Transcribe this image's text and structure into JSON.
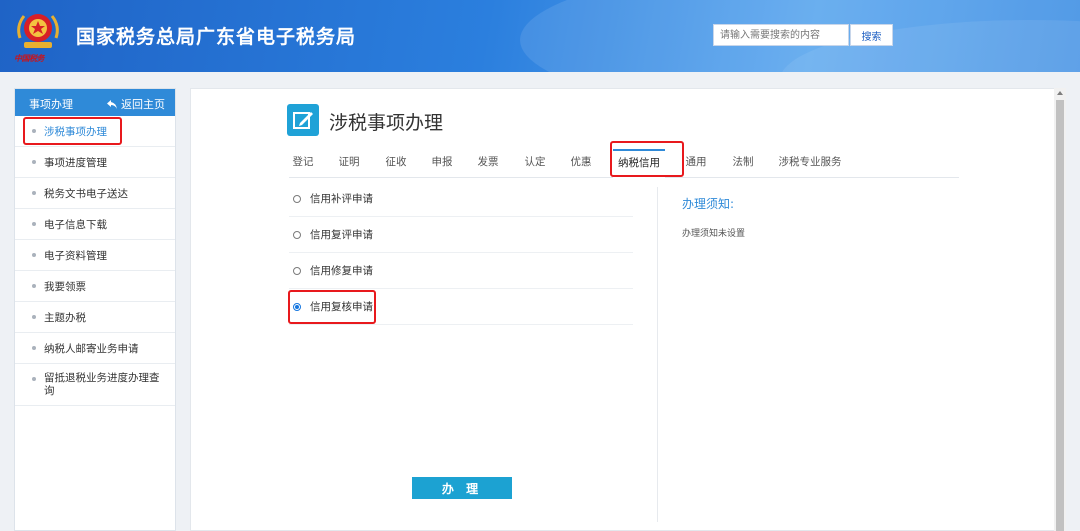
{
  "header": {
    "site_title": "国家税务总局广东省电子税务局",
    "slogan": "中国税务",
    "search_placeholder": "请输入需要搜索的内容",
    "search_button": "搜索"
  },
  "sidebar": {
    "title": "事项办理",
    "back_label": "返回主页",
    "items": [
      {
        "label": "涉税事项办理",
        "active": true
      },
      {
        "label": "事项进度管理"
      },
      {
        "label": "税务文书电子送达"
      },
      {
        "label": "电子信息下载"
      },
      {
        "label": "电子资料管理"
      },
      {
        "label": "我要领票"
      },
      {
        "label": "主题办税"
      },
      {
        "label": "纳税人邮寄业务申请"
      },
      {
        "label": "留抵退税业务进度办理查询"
      }
    ]
  },
  "main": {
    "page_title": "涉税事项办理",
    "tabs": [
      "登记",
      "证明",
      "征收",
      "申报",
      "发票",
      "认定",
      "优惠",
      "纳税信用",
      "通用",
      "法制",
      "涉税专业服务"
    ],
    "active_tab": "纳税信用",
    "options": [
      {
        "label": "信用补评申请",
        "checked": false
      },
      {
        "label": "信用复评申请",
        "checked": false
      },
      {
        "label": "信用修复申请",
        "checked": false
      },
      {
        "label": "信用复核申请",
        "checked": true
      }
    ],
    "notice_title": "办理须知:",
    "notice_text": "办理须知未设置",
    "submit_label": "办 理"
  },
  "colors": {
    "accent": "#2f8ad8",
    "highlight_box": "#e8191d",
    "submit": "#1ca2d2"
  }
}
